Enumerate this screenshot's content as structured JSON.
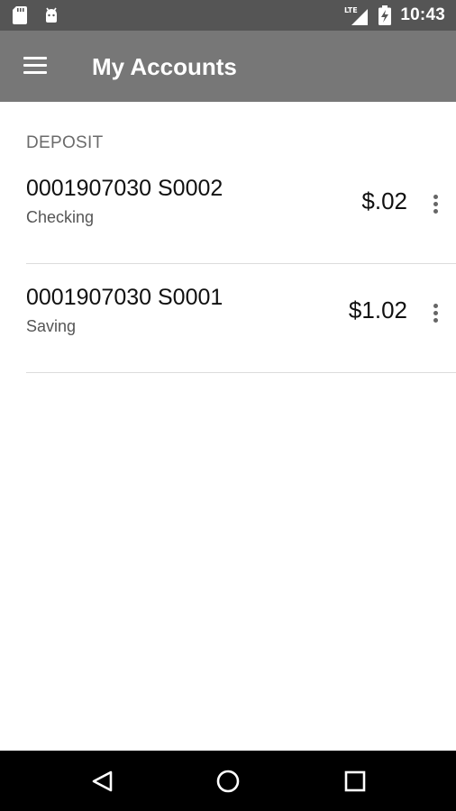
{
  "status_bar": {
    "time": "10:43",
    "icons": [
      "sd-card-icon",
      "android-icon",
      "lte-signal-icon",
      "battery-icon"
    ]
  },
  "app_bar": {
    "title": "My Accounts",
    "menu_icon": "menu-icon"
  },
  "accounts": {
    "section_title": "DEPOSIT",
    "items": [
      {
        "number": "0001907030 S0002",
        "type": "Checking",
        "balance": "$.02"
      },
      {
        "number": "0001907030 S0001",
        "type": "Saving",
        "balance": "$1.02"
      }
    ]
  },
  "nav_bar": {
    "icons": [
      "back-icon",
      "home-icon",
      "recents-icon"
    ]
  },
  "colors": {
    "status_bar": "#555555",
    "app_bar": "#777777",
    "nav_bar": "#000000",
    "section_header": "#6b6b6b",
    "divider": "#dcdcdc"
  }
}
